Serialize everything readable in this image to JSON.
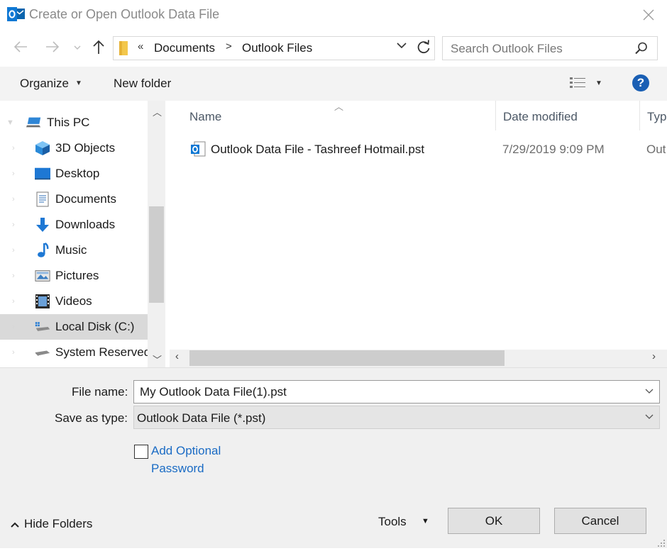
{
  "window": {
    "title": "Create or Open Outlook Data File",
    "app_icon": "outlook-icon",
    "close_icon": "close-icon"
  },
  "nav": {
    "back_icon": "back-arrow-icon",
    "forward_icon": "forward-arrow-icon",
    "recent_icon": "chevron-down-icon",
    "up_icon": "up-arrow-icon",
    "refresh_icon": "refresh-icon"
  },
  "address": {
    "prefix": "«",
    "segments": [
      "Documents",
      "Outlook Files"
    ],
    "separator": ">",
    "dropdown": "chevron-down-icon"
  },
  "search": {
    "placeholder": "Search Outlook Files",
    "value": "",
    "icon": "search-icon"
  },
  "toolbar": {
    "organize": "Organize",
    "new_folder": "New folder",
    "view_icon": "details-view-icon",
    "help": "?"
  },
  "sidebar": {
    "items": [
      {
        "label": "This PC",
        "icon": "computer-icon"
      },
      {
        "label": "3D Objects",
        "icon": "cube-icon"
      },
      {
        "label": "Desktop",
        "icon": "desktop-icon"
      },
      {
        "label": "Documents",
        "icon": "document-icon"
      },
      {
        "label": "Downloads",
        "icon": "download-arrow-icon"
      },
      {
        "label": "Music",
        "icon": "music-note-icon"
      },
      {
        "label": "Pictures",
        "icon": "pictures-icon"
      },
      {
        "label": "Videos",
        "icon": "film-icon"
      },
      {
        "label": "Local Disk (C:)",
        "icon": "drive-icon",
        "selected": true
      },
      {
        "label": "System Reserved",
        "icon": "drive-icon"
      }
    ]
  },
  "files": {
    "columns": [
      "Name",
      "Date modified",
      "Typ"
    ],
    "rows": [
      {
        "name": "Outlook Data File - Tashreef Hotmail.pst",
        "date": "7/29/2019 9:09 PM",
        "type": "Out",
        "icon": "outlook-data-file-icon"
      }
    ]
  },
  "form": {
    "file_name_label": "File name:",
    "file_name_value": "My Outlook Data File(1).pst",
    "save_type_label": "Save as type:",
    "save_type_value": "Outlook Data File (*.pst)",
    "password_line1": "Add Optional",
    "password_line2": "Password",
    "password_checked": false
  },
  "footer": {
    "hide_folders": "Hide Folders",
    "tools": "Tools",
    "ok": "OK",
    "cancel": "Cancel"
  },
  "colors": {
    "accent": "#1a5fb4",
    "link": "#1a6bc4",
    "selected_bg": "#d9d9d9",
    "panel_bg": "#f0f0f0"
  }
}
